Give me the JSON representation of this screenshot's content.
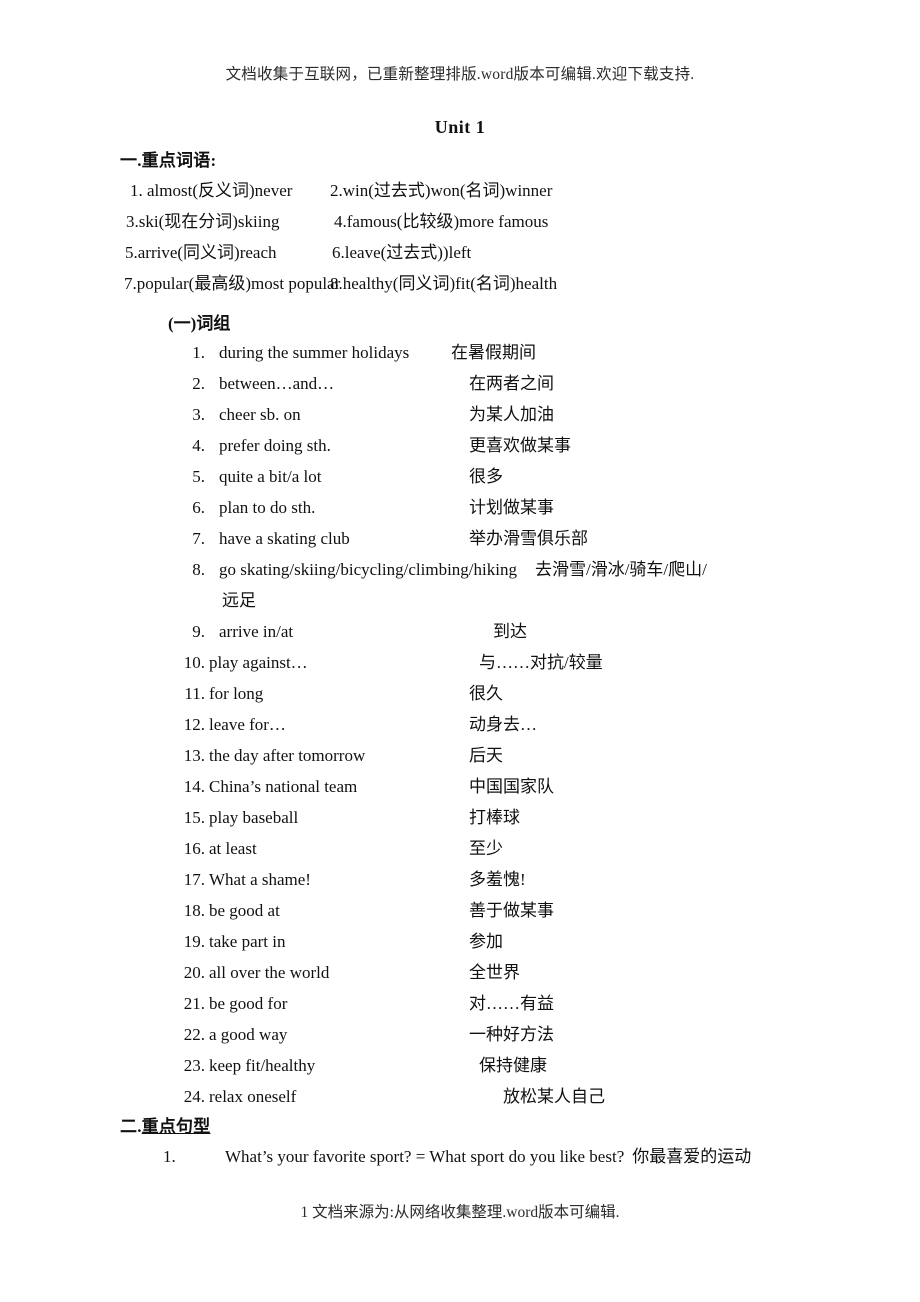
{
  "header": {
    "watermark": "文档收集于互联网，已重新整理排版.word版本可编辑.欢迎下载支持."
  },
  "title": "Unit 1",
  "section_one": {
    "heading": "一.重点词语:",
    "word_pairs": [
      {
        "left": "1. almost(反义词)never",
        "right": "2.win(过去式)won(名词)winner"
      },
      {
        "left": "3.ski(现在分词)skiing",
        "right": "4.famous(比较级)more famous"
      },
      {
        "left": "5.arrive(同义词)reach",
        "right": "6.leave(过去式))left"
      },
      {
        "left": "7.popular(最高级)most popular",
        "right": "8.healthy(同义词)fit(名词)health"
      }
    ],
    "sub_heading": "(一)词组",
    "phrases": [
      {
        "num": "1.",
        "en": "during the summer holidays",
        "zh": "在暑假期间"
      },
      {
        "num": "2.",
        "en": "between…and…",
        "zh": "在两者之间"
      },
      {
        "num": "3.",
        "en": "cheer sb. on",
        "zh": "为某人加油"
      },
      {
        "num": "4.",
        "en": "prefer doing sth.",
        "zh": "更喜欢做某事"
      },
      {
        "num": "5.",
        "en": "quite a bit/a lot",
        "zh": "很多"
      },
      {
        "num": "6.",
        "en": "plan to do sth.",
        "zh": "计划做某事"
      },
      {
        "num": "7.",
        "en": "have a skating club",
        "zh": "举办滑雪俱乐部"
      },
      {
        "num": "8.",
        "en": "go  skating/skiing/bicycling/climbing/hiking",
        "zh": "去滑雪/滑冰/骑车/爬山/",
        "cont": "远足"
      },
      {
        "num": "9.",
        "en": "arrive in/at",
        "zh": "到达"
      },
      {
        "num": "10.",
        "en": "play against…",
        "zh": "与……对抗/较量"
      },
      {
        "num": "11.",
        "en": "for long",
        "zh": "很久"
      },
      {
        "num": "12.",
        "en": "leave for…",
        "zh": "动身去…"
      },
      {
        "num": "13.",
        "en": "the day after tomorrow",
        "zh": "后天"
      },
      {
        "num": "14.",
        "en": "China’s national team",
        "zh": "中国国家队"
      },
      {
        "num": "15.",
        "en": "play baseball",
        "zh": "打棒球"
      },
      {
        "num": "16.",
        "en": "at least",
        "zh": "至少"
      },
      {
        "num": "17.",
        "en": "What a shame!",
        "zh": "多羞愧!"
      },
      {
        "num": "18.",
        "en": "be good at",
        "zh": "善于做某事"
      },
      {
        "num": "19.",
        "en": "take part in",
        "zh": "参加"
      },
      {
        "num": "20.",
        "en": "all over the world",
        "zh": "全世界"
      },
      {
        "num": "21.",
        "en": "be good for",
        "zh": "对……有益"
      },
      {
        "num": "22.",
        "en": "a good way",
        "zh": "一种好方法"
      },
      {
        "num": "23.",
        "en": "keep fit/healthy",
        "zh": "保持健康"
      },
      {
        "num": "24.",
        "en": "relax oneself",
        "zh": "放松某人自己"
      }
    ]
  },
  "section_two": {
    "heading_prefix": "二.",
    "heading_underlined": "重点句型",
    "sentences": [
      {
        "num": "1.",
        "en": "What’s your favorite sport? = What sport do you like best?",
        "zh": "你最喜爱的运动"
      }
    ]
  },
  "footer": {
    "text": "1 文档来源为:从网络收集整理.word版本可编辑."
  }
}
